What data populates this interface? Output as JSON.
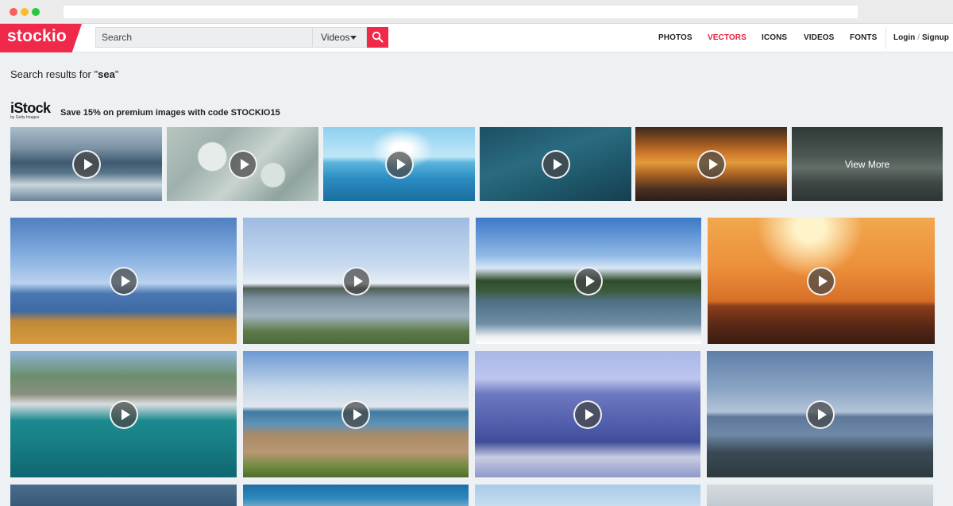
{
  "brand": {
    "name": "stockio",
    "accent": "#f0284a"
  },
  "search": {
    "value": "",
    "placeholder": "Search",
    "type_selected": "Videos",
    "button_icon": "search-icon"
  },
  "nav": {
    "items": [
      {
        "label": "PHOTOS",
        "active": false
      },
      {
        "label": "VECTORS",
        "active": true
      },
      {
        "label": "ICONS",
        "active": false
      },
      {
        "label": "VIDEOS",
        "active": false
      },
      {
        "label": "FONTS",
        "active": false
      }
    ],
    "login": "Login",
    "signup": "Signup",
    "separator": "/"
  },
  "results": {
    "prefix": "Search results for \"",
    "query": "sea",
    "suffix": "\""
  },
  "istock": {
    "logo_text": "iStock",
    "logo_sub": "by Getty Images",
    "promo": "Save 15% on premium images with code STOCKIO15",
    "view_more": "View More",
    "thumbnail_count": 5
  },
  "video_results": {
    "thumbnail_count": 12
  }
}
